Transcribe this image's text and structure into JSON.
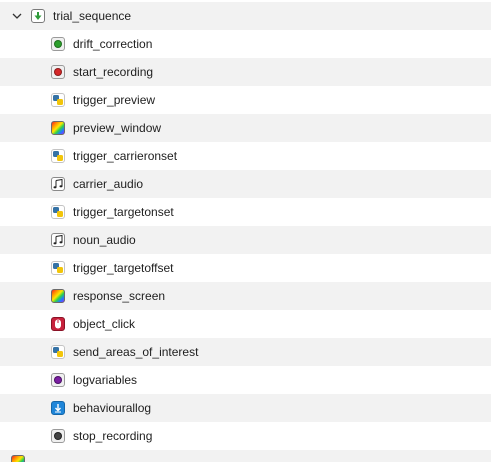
{
  "tree": {
    "root": {
      "label": "trial_sequence",
      "expanded": true,
      "icon": "sequence-icon"
    },
    "items": [
      {
        "label": "drift_correction",
        "icon": "drift-correct-icon"
      },
      {
        "label": "start_recording",
        "icon": "start-record-icon"
      },
      {
        "label": "trigger_preview",
        "icon": "python-script-icon"
      },
      {
        "label": "preview_window",
        "icon": "feedback-display-icon"
      },
      {
        "label": "trigger_carrieronset",
        "icon": "python-script-icon"
      },
      {
        "label": "carrier_audio",
        "icon": "audio-note-icon"
      },
      {
        "label": "trigger_targetonset",
        "icon": "python-script-icon"
      },
      {
        "label": "noun_audio",
        "icon": "audio-note-icon"
      },
      {
        "label": "trigger_targetoffset",
        "icon": "python-script-icon"
      },
      {
        "label": "response_screen",
        "icon": "feedback-display-icon"
      },
      {
        "label": "object_click",
        "icon": "mouse-response-icon"
      },
      {
        "label": "send_areas_of_interest",
        "icon": "python-script-icon"
      },
      {
        "label": "logvariables",
        "icon": "log-variables-icon"
      },
      {
        "label": "behaviourallog",
        "icon": "logger-icon"
      },
      {
        "label": "stop_recording",
        "icon": "stop-record-icon"
      }
    ],
    "next_sibling": {
      "label": "",
      "icon": "feedback-display-icon"
    }
  },
  "colors": {
    "row_alt": "#f2f2f2",
    "text": "#1e1e1e",
    "green_dot": "#2ca02c",
    "red_dot": "#d62728",
    "purple_dot": "#7b1fa2",
    "grey_dot": "#444444"
  }
}
